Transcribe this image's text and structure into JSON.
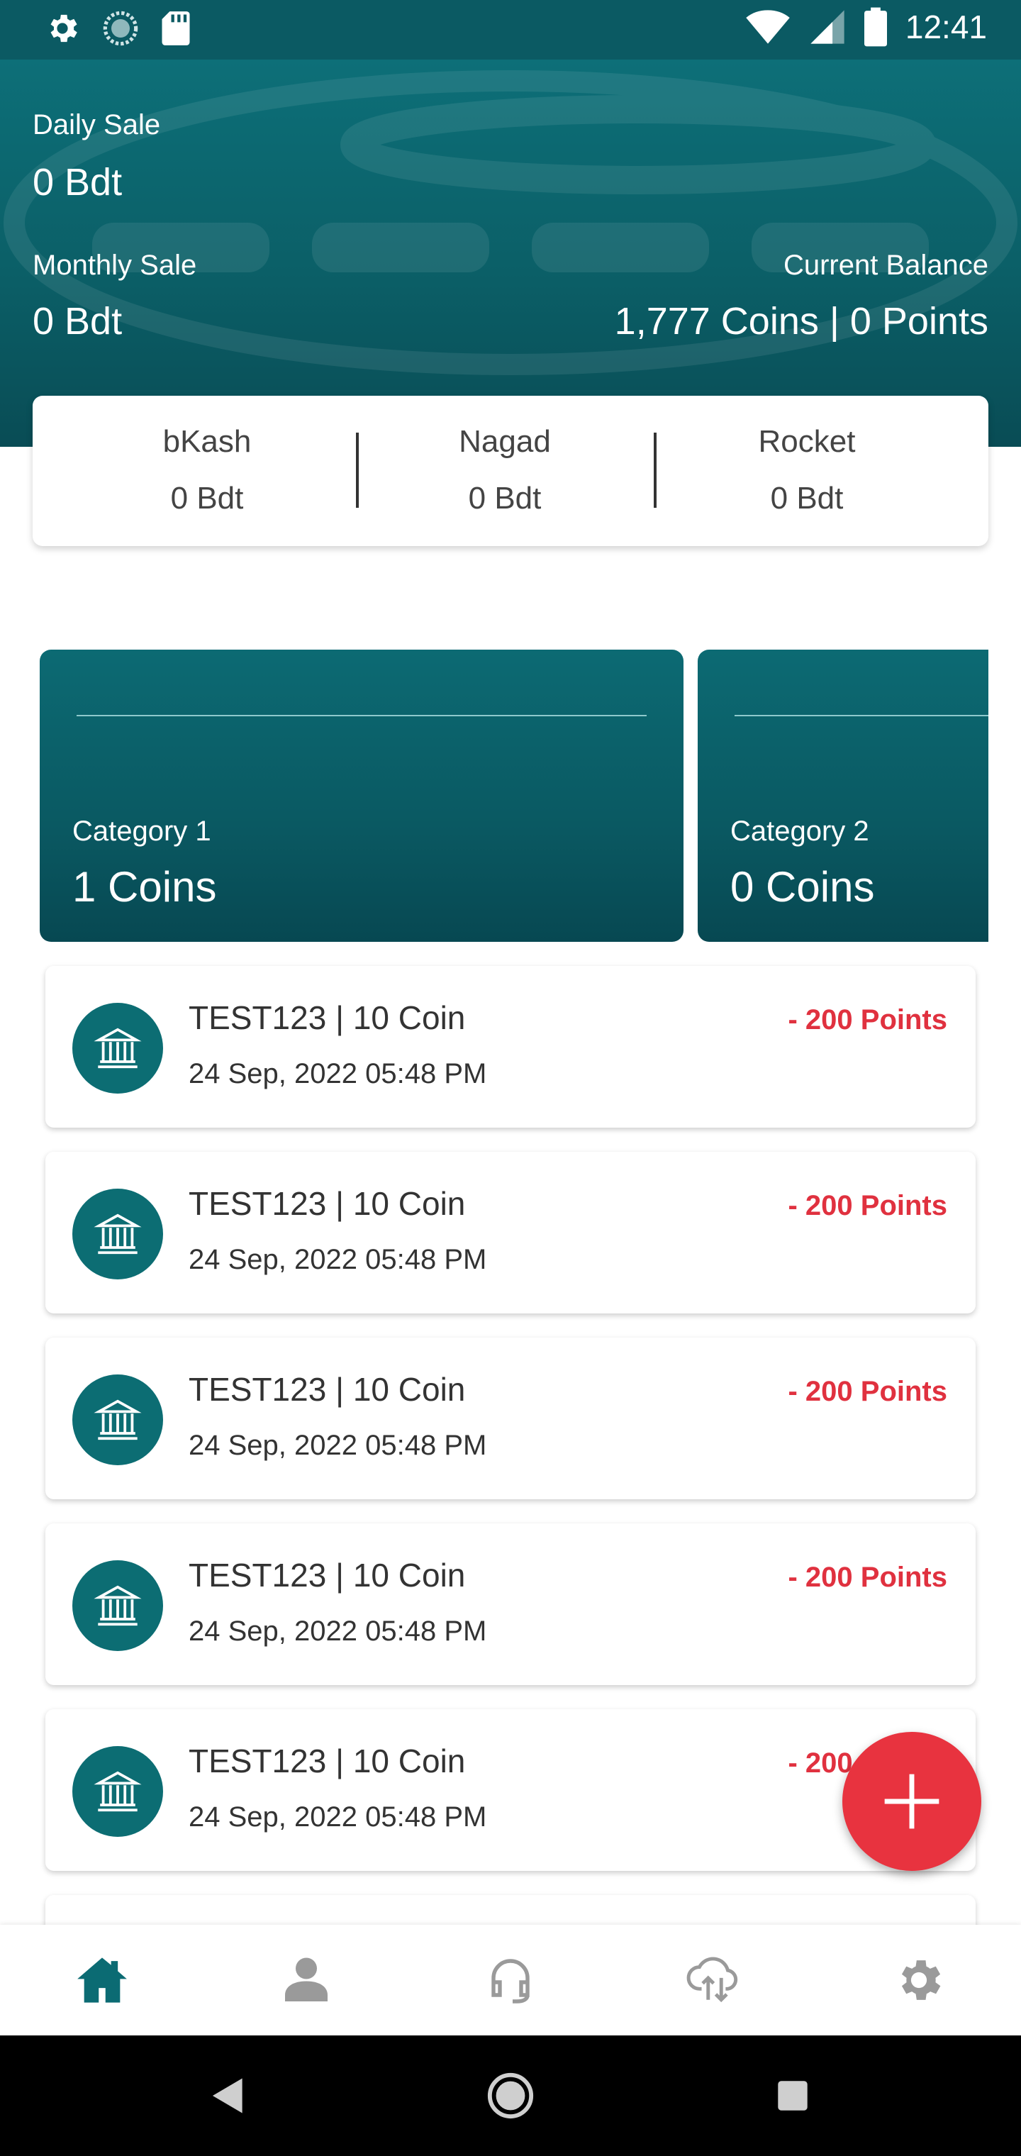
{
  "status_bar": {
    "time": "12:41",
    "icons": [
      "settings-icon",
      "sync-icon",
      "sd-card-icon",
      "wifi-icon",
      "signal-icon",
      "battery-icon"
    ]
  },
  "header": {
    "daily_sale_label": "Daily Sale",
    "daily_sale_value": "0 Bdt",
    "monthly_sale_label": "Monthly Sale",
    "monthly_sale_value": "0 Bdt",
    "current_balance_label": "Current Balance",
    "current_balance_value": "1,777 Coins | 0 Points"
  },
  "payments": [
    {
      "name": "bKash",
      "amount": "0 Bdt"
    },
    {
      "name": "Nagad",
      "amount": "0 Bdt"
    },
    {
      "name": "Rocket",
      "amount": "0 Bdt"
    }
  ],
  "categories": [
    {
      "label": "Category 1",
      "value": "1 Coins"
    },
    {
      "label": "Category 2",
      "value": "0 Coins"
    }
  ],
  "transactions": [
    {
      "title": "TEST123 | 10 Coin",
      "date": "24 Sep, 2022 05:48 PM",
      "points": "- 200 Points",
      "icon": "bank-icon"
    },
    {
      "title": "TEST123 | 10 Coin",
      "date": "24 Sep, 2022 05:48 PM",
      "points": "- 200 Points",
      "icon": "bank-icon"
    },
    {
      "title": "TEST123 | 10 Coin",
      "date": "24 Sep, 2022 05:48 PM",
      "points": "- 200 Points",
      "icon": "bank-icon"
    },
    {
      "title": "TEST123 | 10 Coin",
      "date": "24 Sep, 2022 05:48 PM",
      "points": "- 200 Points",
      "icon": "bank-icon"
    },
    {
      "title": "TEST123 | 10 Coin",
      "date": "24 Sep, 2022 05:48 PM",
      "points": "- 200 Points",
      "icon": "bank-icon"
    }
  ],
  "fab": {
    "icon": "plus-icon"
  },
  "bottom_nav": [
    {
      "name": "home",
      "icon": "home-icon",
      "active": true
    },
    {
      "name": "profile",
      "icon": "person-icon",
      "active": false
    },
    {
      "name": "support",
      "icon": "headset-icon",
      "active": false
    },
    {
      "name": "sync",
      "icon": "cloud-sync-icon",
      "active": false
    },
    {
      "name": "settings",
      "icon": "gear-icon",
      "active": false
    }
  ],
  "colors": {
    "primary": "#0b5f67",
    "accent": "#e8333f",
    "nav_active": "#0b6b73",
    "nav_inactive": "#9a9a9a"
  }
}
